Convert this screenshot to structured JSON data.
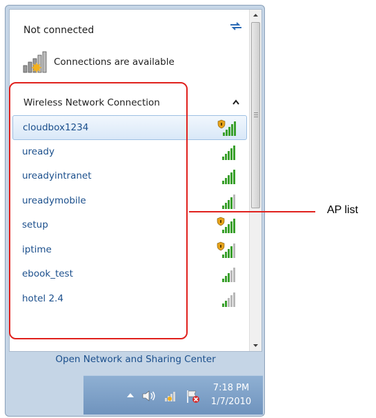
{
  "status": {
    "title": "Not connected",
    "connections_label": "Connections are available"
  },
  "section": {
    "title": "Wireless Network Connection"
  },
  "networks": [
    {
      "name": "cloudbox1234",
      "secured": true,
      "selected": true,
      "strength": 5
    },
    {
      "name": "uready",
      "secured": false,
      "selected": false,
      "strength": 5
    },
    {
      "name": "ureadyintranet",
      "secured": false,
      "selected": false,
      "strength": 5
    },
    {
      "name": "ureadymobile",
      "secured": false,
      "selected": false,
      "strength": 4
    },
    {
      "name": "setup",
      "secured": true,
      "selected": false,
      "strength": 5
    },
    {
      "name": "iptime",
      "secured": true,
      "selected": false,
      "strength": 4
    },
    {
      "name": "ebook_test",
      "secured": false,
      "selected": false,
      "strength": 3
    },
    {
      "name": "hotel 2.4",
      "secured": false,
      "selected": false,
      "strength": 2
    }
  ],
  "footer": {
    "link": "Open Network and Sharing Center"
  },
  "taskbar": {
    "time": "7:18 PM",
    "date": "1/7/2010"
  },
  "annotation": {
    "label": "AP list"
  },
  "colors": {
    "link": "#1b4f8c",
    "signal_green": "#3aa02c",
    "signal_grey": "#b8b8b8",
    "annotation_red": "#e0201c"
  },
  "icons": {
    "refresh": "refresh-icon",
    "connections": "network-bars-icon",
    "chevron": "chevron-up-icon",
    "signal": "wifi-signal-icon",
    "shield": "security-shield-icon",
    "tray_arrow": "show-hidden-icons-icon",
    "volume": "volume-icon",
    "network": "network-tray-icon",
    "action_center": "action-center-flag-icon"
  }
}
